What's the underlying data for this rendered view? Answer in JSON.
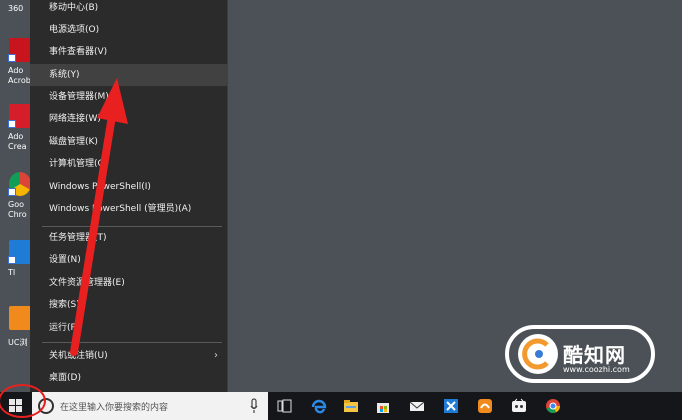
{
  "desktop": {
    "icons": [
      {
        "label": "360",
        "color": "#3a7be0",
        "icon": "app-360-icon"
      },
      {
        "label": "Ado\nAcrob",
        "color": "#c8141c",
        "icon": "acrobat-icon"
      },
      {
        "label": "Ado\nCrea",
        "color": "#d61d2a",
        "icon": "creative-cloud-icon"
      },
      {
        "label": "Goo\nChro",
        "color": "#4a90e2",
        "icon": "chrome-icon"
      },
      {
        "label": "TI",
        "color": "#1e7bd6",
        "icon": "app-ti-icon"
      },
      {
        "label": "UC浏",
        "color": "#f08a1c",
        "icon": "uc-browser-icon"
      }
    ]
  },
  "menu": {
    "items": [
      {
        "label": "移动中心(B)",
        "name": "menu-item-mobility-center"
      },
      {
        "label": "电源选项(O)",
        "name": "menu-item-power-options"
      },
      {
        "label": "事件查看器(V)",
        "name": "menu-item-event-viewer"
      },
      {
        "label": "系统(Y)",
        "name": "menu-item-system"
      },
      {
        "label": "设备管理器(M)",
        "name": "menu-item-device-manager"
      },
      {
        "label": "网络连接(W)",
        "name": "menu-item-network-connections"
      },
      {
        "label": "磁盘管理(K)",
        "name": "menu-item-disk-management"
      },
      {
        "label": "计算机管理(G)",
        "name": "menu-item-computer-management"
      },
      {
        "label": "Windows PowerShell(I)",
        "name": "menu-item-powershell"
      },
      {
        "label": "Windows PowerShell (管理员)(A)",
        "name": "menu-item-powershell-admin"
      },
      {
        "label": "任务管理器(T)",
        "name": "menu-item-task-manager"
      },
      {
        "label": "设置(N)",
        "name": "menu-item-settings"
      },
      {
        "label": "文件资源管理器(E)",
        "name": "menu-item-file-explorer"
      },
      {
        "label": "搜索(S)",
        "name": "menu-item-search"
      },
      {
        "label": "运行(R)",
        "name": "menu-item-run"
      },
      {
        "label": "关机或注销(U)",
        "name": "menu-item-shutdown"
      },
      {
        "label": "桌面(D)",
        "name": "menu-item-desktop"
      }
    ],
    "highlighted": "系统(Y)"
  },
  "taskbar": {
    "search_placeholder": "在这里输入你要搜索的内容",
    "pinned": [
      "task-view-icon",
      "edge-icon",
      "file-explorer-icon",
      "store-icon",
      "mail-icon",
      "app-blue-icon",
      "uc-browser-icon",
      "app-green-icon",
      "chrome-icon"
    ]
  },
  "watermark": {
    "name": "酷知网",
    "url": "www.coozhi.com"
  },
  "colors": {
    "desktop_bg": "#4b5157",
    "menu_bg": "#2b2b2b",
    "annotation_red": "#e82020"
  }
}
